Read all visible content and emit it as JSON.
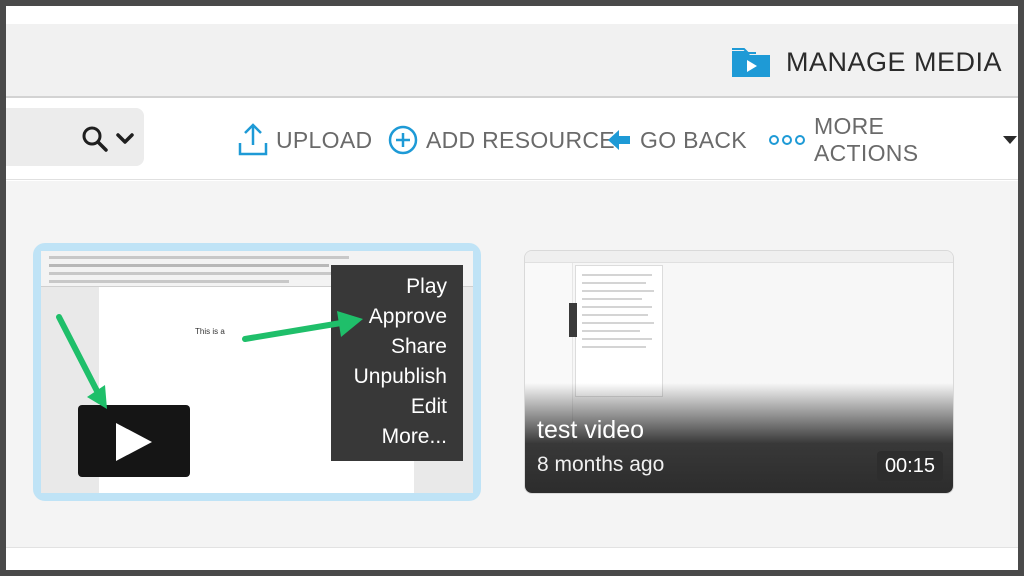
{
  "header": {
    "title": "MANAGE MEDIA",
    "title_icon": "folder-play-icon"
  },
  "toolbar": {
    "search_icon": "search-icon",
    "dropdown_icon": "chevron-down-icon",
    "upload_label": "UPLOAD",
    "add_resource_label": "ADD RESOURCE",
    "go_back_label": "GO BACK",
    "more_actions_label": "MORE ACTIONS"
  },
  "media": [
    {
      "thumbnail_text": "This is a",
      "menu": [
        "Play",
        "Approve",
        "Share",
        "Unpublish",
        "Edit",
        "More..."
      ]
    },
    {
      "title": "test video",
      "age": "8 months ago",
      "duration": "00:15"
    }
  ],
  "colors": {
    "accent": "#1e9ad6",
    "annotation_arrow": "#1fbf6a",
    "selection_border": "#bfe3f6"
  }
}
